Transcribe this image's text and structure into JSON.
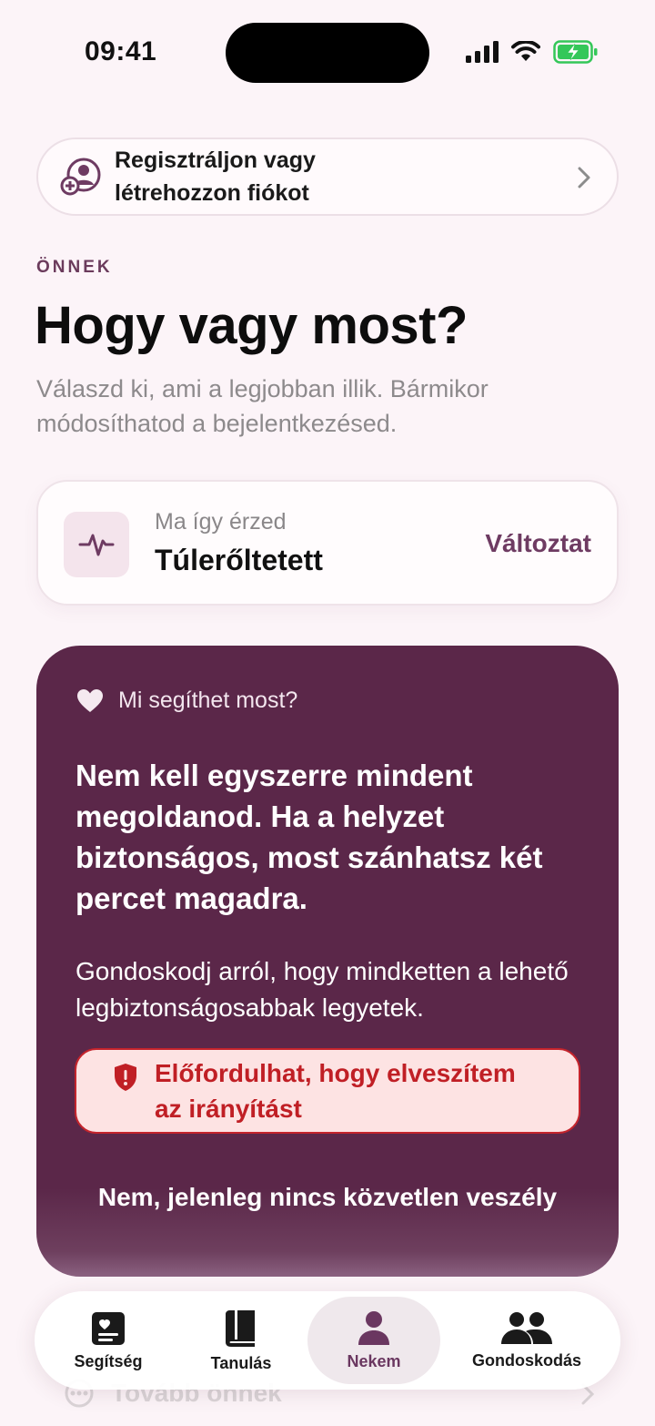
{
  "status": {
    "time": "09:41"
  },
  "register": {
    "text_line1": "Regisztráljon vagy",
    "text_line2": "létrehozzon fiókot"
  },
  "section": {
    "eyebrow": "ÖNNEK",
    "title": "Hogy vagy most?",
    "subtitle": "Válaszd ki, ami a legjobban illik. Bármikor módosíthatod a bejelentkezésed."
  },
  "feeling": {
    "label": "Ma így érzed",
    "value": "Túlerőltetett",
    "change": "Változtat",
    "icon": "pulse-icon"
  },
  "help": {
    "heading": "Mi segíthet most?",
    "main": "Nem kell egyszerre mindent megoldanod. Ha a helyzet biztonságos, most szánhatsz két percet magadra.",
    "sub": "Gondoskodj arról, hogy mindketten a lehető legbiztonságosabbak legyetek.",
    "danger_line1": "Előfordulhat, hogy elveszítem",
    "danger_line2": "az irányítást",
    "no_danger": "Nem, jelenleg nincs közvetlen veszély"
  },
  "faded": {
    "label": "Tovább önnek"
  },
  "tabs": [
    {
      "label": "Segítség",
      "icon": "help-card-icon"
    },
    {
      "label": "Tanulás",
      "icon": "book-icon"
    },
    {
      "label": "Nekem",
      "icon": "person-icon",
      "active": true
    },
    {
      "label": "Gondoskodás",
      "icon": "people-icon"
    }
  ],
  "colors": {
    "background": "#fcf4f8",
    "accent": "#6e3b62",
    "card_purple": "#5b2749",
    "danger": "#c01f25",
    "battery": "#34c759"
  }
}
